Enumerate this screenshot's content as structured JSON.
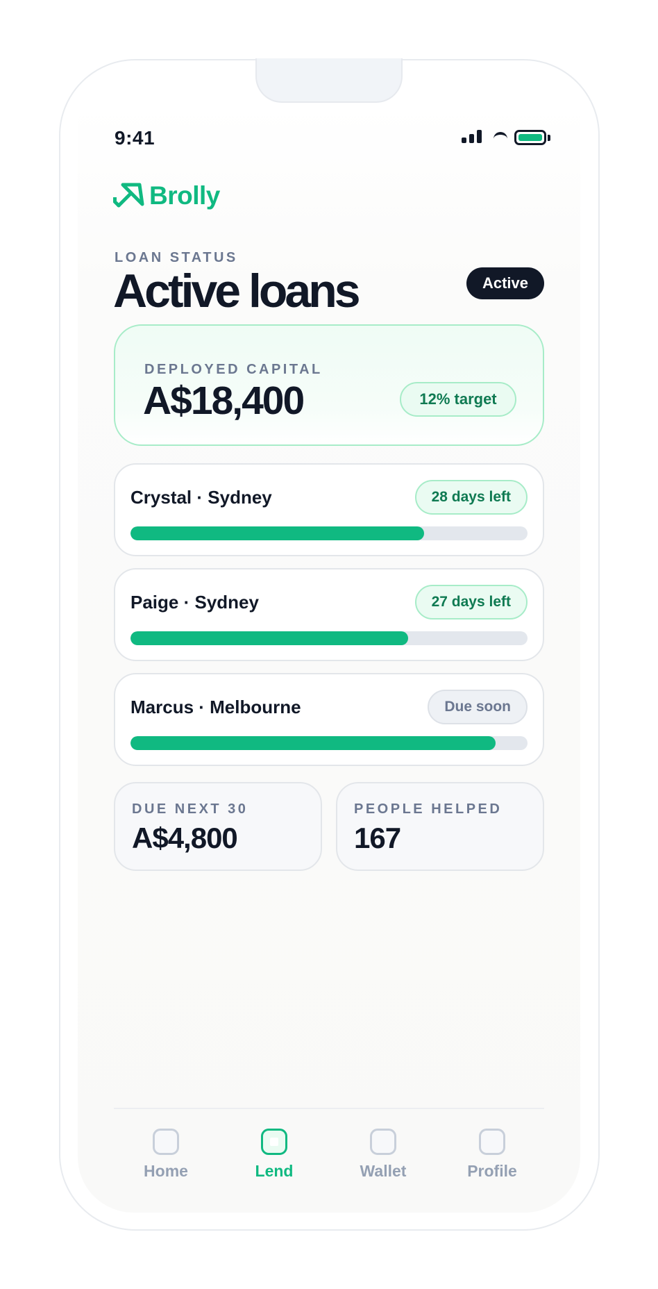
{
  "status_bar": {
    "time": "9:41"
  },
  "brand": {
    "name": "Brolly",
    "logo_icon": "umbrella-icon",
    "color": "#10b981"
  },
  "header": {
    "eyebrow": "LOAN STATUS",
    "title": "Active loans",
    "status_badge": "Active"
  },
  "capital": {
    "label": "DEPLOYED CAPITAL",
    "value": "A$18,400",
    "target": "12% target"
  },
  "loans": [
    {
      "name": "Crystal · Sydney",
      "badge": "28 days left",
      "badge_tone": "green",
      "progress": 0.74
    },
    {
      "name": "Paige · Sydney",
      "badge": "27 days left",
      "badge_tone": "green",
      "progress": 0.7
    },
    {
      "name": "Marcus · Melbourne",
      "badge": "Due soon",
      "badge_tone": "gray",
      "progress": 0.92
    }
  ],
  "stats": [
    {
      "label": "DUE NEXT 30",
      "value": "A$4,800"
    },
    {
      "label": "PEOPLE HELPED",
      "value": "167"
    }
  ],
  "tabs": [
    {
      "label": "Home",
      "icon": "home-icon",
      "active": false
    },
    {
      "label": "Lend",
      "icon": "lend-icon",
      "active": true
    },
    {
      "label": "Wallet",
      "icon": "wallet-icon",
      "active": false
    },
    {
      "label": "Profile",
      "icon": "profile-icon",
      "active": false
    }
  ],
  "colors": {
    "accent": "#10b981",
    "ink": "#111827",
    "muted": "#6b7790"
  }
}
